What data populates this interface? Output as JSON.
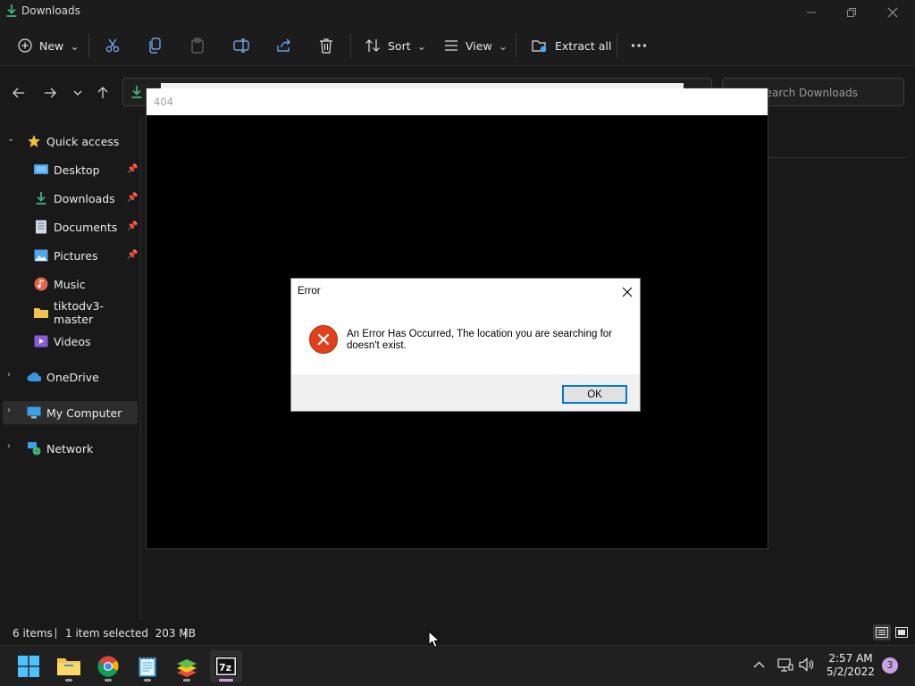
{
  "window": {
    "title": "Downloads"
  },
  "commandbar": {
    "new_label": "New",
    "sort_label": "Sort",
    "view_label": "View",
    "extract_label": "Extract all"
  },
  "search": {
    "placeholder": "Search Downloads"
  },
  "sidebar": {
    "quick_access": "Quick access",
    "items": [
      {
        "label": "Desktop",
        "pinned": true
      },
      {
        "label": "Downloads",
        "pinned": true
      },
      {
        "label": "Documents",
        "pinned": true
      },
      {
        "label": "Pictures",
        "pinned": true
      },
      {
        "label": "Music",
        "pinned": false
      },
      {
        "label": "tiktodv3-master",
        "pinned": false
      },
      {
        "label": "Videos",
        "pinned": false
      }
    ],
    "onedrive": "OneDrive",
    "my_computer": "My Computer",
    "network": "Network"
  },
  "browser_window": {
    "title": "404"
  },
  "dialog": {
    "title": "Error",
    "message": "An Error Has Occurred, The location you are searching for doesn't exist.",
    "ok_label": "OK"
  },
  "status": {
    "item_count": "6 items",
    "selection": "1 item selected  203 MB"
  },
  "taskbar": {
    "time": "2:57 AM",
    "date": "5/2/2022",
    "notifications": "3"
  },
  "colors": {
    "accent": "#0078d7",
    "error_icon": "#e0401c",
    "notif_badge": "#c9a2e0"
  }
}
